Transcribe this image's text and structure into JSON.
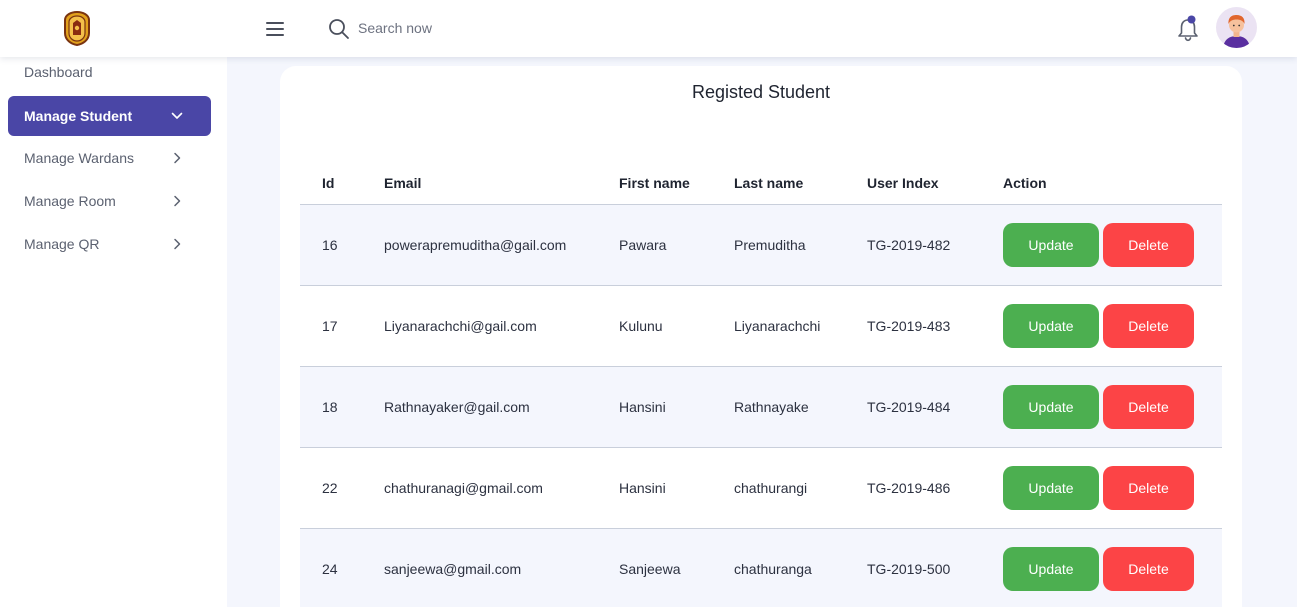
{
  "header": {
    "search_placeholder": "Search now"
  },
  "sidebar": {
    "items": [
      {
        "label": "Dashboard"
      },
      {
        "label": "Manage Student"
      },
      {
        "label": "Manage Wardans"
      },
      {
        "label": "Manage Room"
      },
      {
        "label": "Manage QR"
      }
    ]
  },
  "main": {
    "title": "Registed Student",
    "columns": [
      "Id",
      "Email",
      "First name",
      "Last name",
      "User Index",
      "Action"
    ],
    "rows": [
      {
        "id": "16",
        "email": "powerapremuditha@gail.com",
        "first": "Pawara",
        "last": "Premuditha",
        "index": "TG-2019-482"
      },
      {
        "id": "17",
        "email": "Liyanarachchi@gail.com",
        "first": "Kulunu",
        "last": "Liyanarachchi",
        "index": "TG-2019-483"
      },
      {
        "id": "18",
        "email": "Rathnayaker@gail.com",
        "first": "Hansini",
        "last": "Rathnayake",
        "index": "TG-2019-484"
      },
      {
        "id": "22",
        "email": "chathuranagi@gmail.com",
        "first": "Hansini",
        "last": "chathurangi",
        "index": "TG-2019-486"
      },
      {
        "id": "24",
        "email": "sanjeewa@gmail.com",
        "first": "Sanjeewa",
        "last": "chathuranga",
        "index": "TG-2019-500"
      }
    ],
    "update_label": "Update",
    "delete_label": "Delete"
  },
  "colors": {
    "accent": "#4a46a6",
    "update": "#4caf50",
    "delete": "#fc4446",
    "notification_dot": "#4a46a6"
  },
  "icons": [
    "logo-emblem",
    "menu-icon",
    "search-icon",
    "bell-icon",
    "avatar",
    "chevron-down-icon",
    "chevron-right-icon"
  ]
}
